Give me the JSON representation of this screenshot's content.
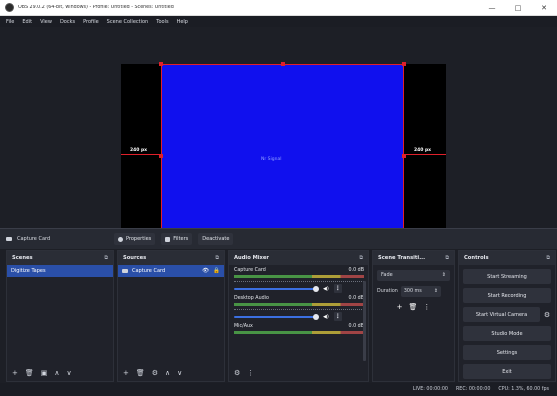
{
  "window": {
    "title": "OBS 29.0.2 (64-bit, windows) - Profile: Untitled - Scenes: Untitled",
    "minimize": "—",
    "maximize": "□",
    "close": "✕"
  },
  "menu": [
    "File",
    "Edit",
    "View",
    "Docks",
    "Profile",
    "Scene Collection",
    "Tools",
    "Help"
  ],
  "preview": {
    "left_guide_label": "240 px",
    "right_guide_label": "240 px",
    "center_text": "Nr Signal",
    "canvas_color": "#1010ee",
    "selection_color": "#e0202a"
  },
  "context_bar": {
    "source_name": "Capture Card",
    "properties": "Properties",
    "filters": "Filters",
    "deactivate": "Deactivate"
  },
  "scenes": {
    "title": "Scenes",
    "items": [
      "Digitize Tapes"
    ],
    "footer": [
      "+",
      "🗑",
      "▣",
      "∧",
      "∨"
    ]
  },
  "sources": {
    "title": "Sources",
    "items": [
      {
        "name": "Capture Card",
        "visible_icon": "👁",
        "lock_icon": "🔒"
      }
    ],
    "footer": [
      "+",
      "🗑",
      "⚙",
      "∧",
      "∨"
    ]
  },
  "mixer": {
    "title": "Audio Mixer",
    "channels": [
      {
        "name": "Capture Card",
        "db": "0.0 dB"
      },
      {
        "name": "Desktop Audio",
        "db": "0.0 dB"
      },
      {
        "name": "Mic/Aux",
        "db": "0.0 dB"
      }
    ],
    "footer": [
      "⚙",
      "⋮"
    ]
  },
  "transitions": {
    "title": "Scene Transiti...",
    "type": "Fade",
    "duration_label": "Duration",
    "duration_value": "300 ms",
    "actions": [
      "+",
      "🗑",
      "⋮"
    ]
  },
  "controls": {
    "title": "Controls",
    "buttons": [
      "Start Streaming",
      "Start Recording",
      "Start Virtual Camera",
      "Studio Mode",
      "Settings",
      "Exit"
    ]
  },
  "status": {
    "live": "LIVE: 00:00:00",
    "rec": "REC: 00:00:00",
    "cpu": "CPU: 1.3%, 60.00 fps"
  }
}
